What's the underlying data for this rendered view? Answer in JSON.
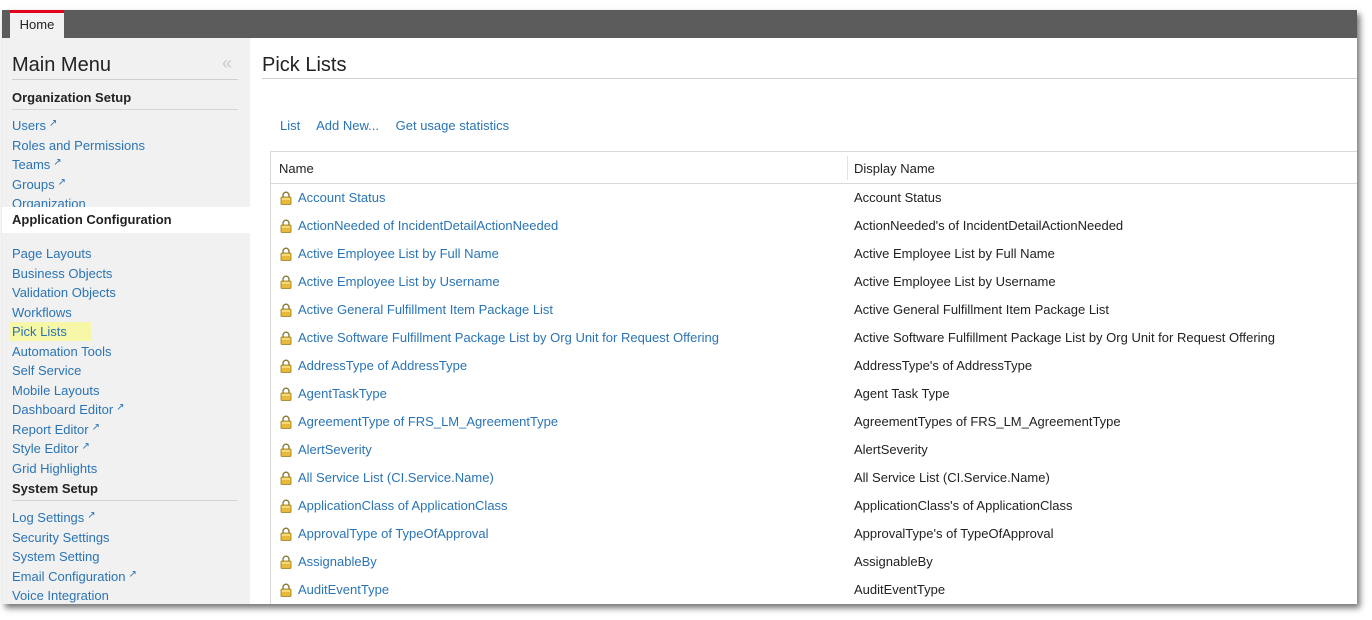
{
  "topbar": {
    "home_tab": "Home"
  },
  "sidebar": {
    "title": "Main Menu",
    "sections": [
      {
        "heading": "Organization Setup",
        "items": [
          {
            "label": "Users",
            "external": true
          },
          {
            "label": "Roles and Permissions",
            "external": false
          },
          {
            "label": "Teams",
            "external": true
          },
          {
            "label": "Groups",
            "external": true
          },
          {
            "label": "Organization",
            "external": false
          }
        ]
      },
      {
        "heading": "Application Configuration",
        "items": [
          {
            "label": "Page Layouts",
            "external": false
          },
          {
            "label": "Business Objects",
            "external": false
          },
          {
            "label": "Validation Objects",
            "external": false
          },
          {
            "label": "Workflows",
            "external": false
          },
          {
            "label": "Pick Lists",
            "external": false,
            "active": true
          },
          {
            "label": "Automation Tools",
            "external": false
          },
          {
            "label": "Self Service",
            "external": false
          },
          {
            "label": "Mobile Layouts",
            "external": false
          },
          {
            "label": "Dashboard Editor",
            "external": true
          },
          {
            "label": "Report Editor",
            "external": true
          },
          {
            "label": "Style Editor",
            "external": true
          },
          {
            "label": "Grid Highlights",
            "external": false
          }
        ]
      },
      {
        "heading": "System Setup",
        "items": [
          {
            "label": "Log Settings",
            "external": true
          },
          {
            "label": "Security Settings",
            "external": false
          },
          {
            "label": "System Setting",
            "external": false
          },
          {
            "label": "Email Configuration",
            "external": true
          },
          {
            "label": "Voice Integration",
            "external": false
          }
        ]
      }
    ]
  },
  "main": {
    "title": "Pick Lists",
    "actions": [
      "List",
      "Add New...",
      "Get usage statistics"
    ],
    "columns": [
      "Name",
      "Display Name"
    ],
    "rows": [
      {
        "name": "Account Status",
        "display": "Account Status"
      },
      {
        "name": "ActionNeeded of IncidentDetailActionNeeded",
        "display": "ActionNeeded's of IncidentDetailActionNeeded"
      },
      {
        "name": "Active Employee List by Full Name",
        "display": "Active Employee List by Full Name"
      },
      {
        "name": "Active Employee List by Username",
        "display": "Active Employee List by Username"
      },
      {
        "name": "Active General Fulfillment Item Package List",
        "display": "Active General Fulfillment Item Package List"
      },
      {
        "name": "Active Software Fulfillment Package List by Org Unit for Request Offering",
        "display": "Active Software Fulfillment Package List by Org Unit for Request Offering"
      },
      {
        "name": "AddressType of AddressType",
        "display": "AddressType's of AddressType"
      },
      {
        "name": "AgentTaskType",
        "display": "Agent Task Type"
      },
      {
        "name": "AgreementType of FRS_LM_AgreementType",
        "display": "AgreementTypes of FRS_LM_AgreementType"
      },
      {
        "name": "AlertSeverity",
        "display": "AlertSeverity"
      },
      {
        "name": "All Service List (CI.Service.Name)",
        "display": "All Service List (CI.Service.Name)"
      },
      {
        "name": "ApplicationClass of ApplicationClass",
        "display": "ApplicationClass's of ApplicationClass"
      },
      {
        "name": "ApprovalType of TypeOfApproval",
        "display": "ApprovalType's of TypeOfApproval"
      },
      {
        "name": "AssignableBy",
        "display": "AssignableBy"
      },
      {
        "name": "AuditEventType",
        "display": "AuditEventType"
      }
    ]
  },
  "colors": {
    "link": "#2a74b5",
    "topbar": "#5c5c5c",
    "tab_accent": "#e0001b",
    "highlight": "#f6f7a7",
    "sidebar_bg": "#f1f1f1"
  }
}
